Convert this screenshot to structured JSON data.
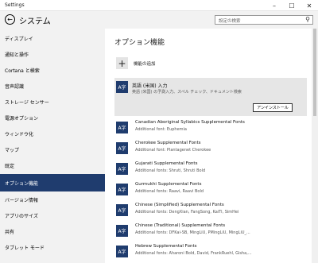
{
  "window": {
    "title": "Settings"
  },
  "header": {
    "title": "システム",
    "search_placeholder": "設定の検索"
  },
  "sidebar": {
    "items": [
      {
        "label": "ディスプレイ"
      },
      {
        "label": "通知と操作"
      },
      {
        "label": "Cortana と検索"
      },
      {
        "label": "音声認識"
      },
      {
        "label": "ストレージ センサー"
      },
      {
        "label": "電源オプション"
      },
      {
        "label": "ウィンドウ化"
      },
      {
        "label": "マップ"
      },
      {
        "label": "既定"
      },
      {
        "label": "オプション機能",
        "active": true
      },
      {
        "label": "バージョン情報"
      },
      {
        "label": "アプリのサイズ"
      },
      {
        "label": "共有"
      },
      {
        "label": "タブレット モード"
      }
    ]
  },
  "main": {
    "section_title": "オプション機能",
    "add_feature_label": "機能の追加",
    "selected": {
      "name": "英語 (米国) 入力",
      "description": "英語 (米国) の予測入力、スペル チェック、ドキュメント検索",
      "uninstall_label": "アンインストール"
    },
    "features": [
      {
        "name": "Canadian Aboriginal Syllabics Supplemental Fonts",
        "desc": "Additional font: Euphemia"
      },
      {
        "name": "Cherokee Supplemental Fonts",
        "desc": "Additional font: Plantagenet Cherokee"
      },
      {
        "name": "Gujarati Supplemental Fonts",
        "desc": "Additional fonts: Shruti, Shruti Bold"
      },
      {
        "name": "Gurmukhi Supplemental Fonts",
        "desc": "Additional fonts: Raavi, Raavi Bold"
      },
      {
        "name": "Chinese (Simplified) Supplemental Fonts",
        "desc": "Additional fonts: DengXian, FangSong, KaiTi, SimHei"
      },
      {
        "name": "Chinese (Traditional) Supplemental Fonts",
        "desc": "Additional fonts: DFKai-SB, MingLiU, PMingLiU, MingLiU_..."
      },
      {
        "name": "Hebrew Supplemental Fonts",
        "desc": "Additional fonts: Aharoni Bold, David, FrankRuehl, Gisha,..."
      }
    ]
  },
  "icons": {
    "feature": "A字"
  }
}
